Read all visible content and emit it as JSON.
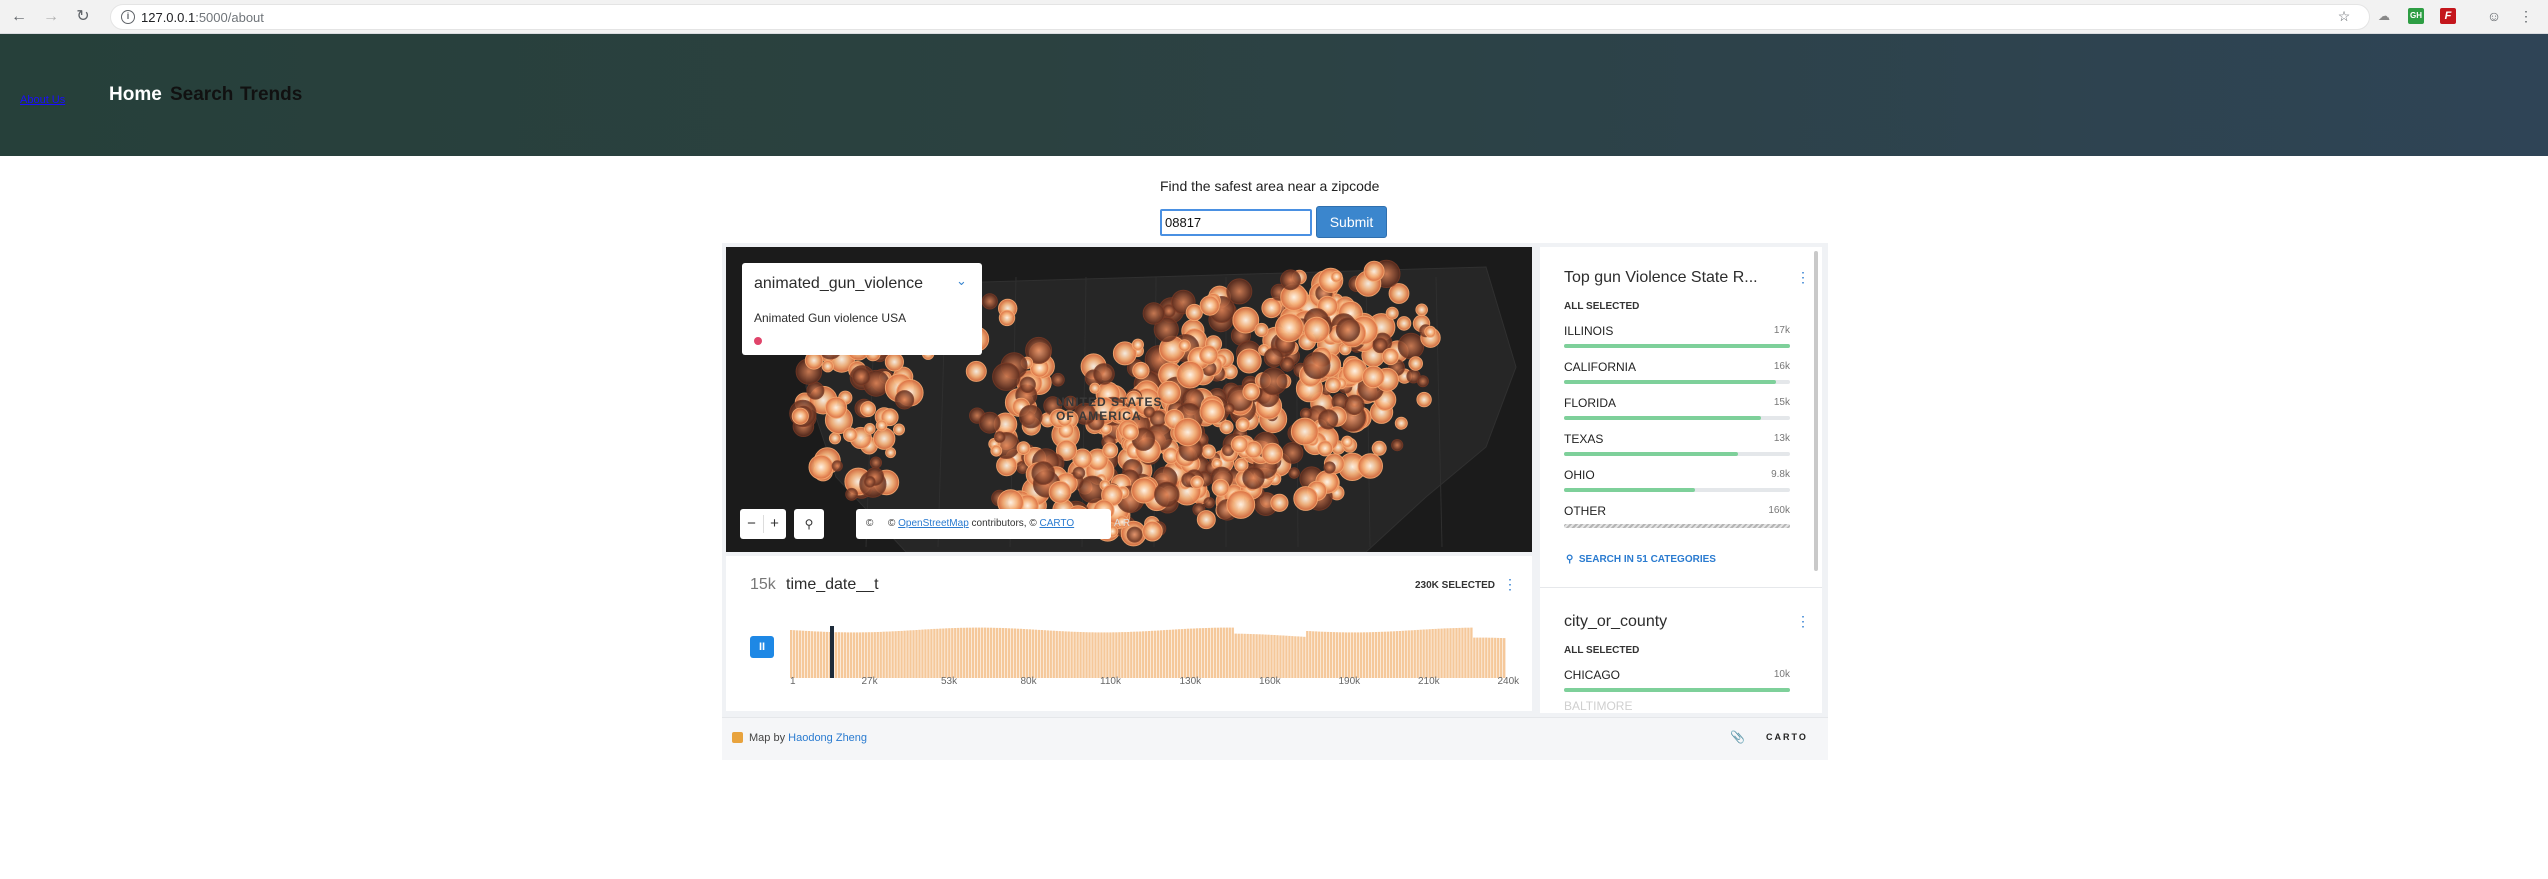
{
  "browser": {
    "url_host": "127.0.0.1",
    "url_path": ":5000/about",
    "ext_ghostery": "GH",
    "ext_flash": "F"
  },
  "header": {
    "logo_link": "About Us",
    "nav": [
      "Home",
      "Search",
      "Trends"
    ]
  },
  "zip_form": {
    "prompt": "Find the safest area near a zipcode",
    "value": "08817",
    "submit_label": "Submit"
  },
  "map": {
    "legend_title": "animated_gun_violence",
    "legend_subtitle": "Animated Gun violence USA",
    "legend_color": "#e0446a",
    "country_label_1": "UNITED STATES",
    "country_label_2": "OF AMERICA",
    "attribution_prefix": "© ",
    "attribution_osm": "OpenStreetMap",
    "attribution_mid": " contributors, © ",
    "attribution_carto": "CARTO",
    "overflow_text": "A R",
    "copyright_glyph": "©",
    "zoom_out": "−",
    "zoom_in": "+"
  },
  "time_series": {
    "count": "15k",
    "name": "time_date__t",
    "selected": "230K SELECTED",
    "play_label": "II",
    "ticks": [
      "1",
      "27k",
      "53k",
      "80k",
      "110k",
      "130k",
      "160k",
      "190k",
      "210k",
      "240k"
    ],
    "bar_color": "#f5c89a"
  },
  "state_widget": {
    "title": "Top gun Violence State R...",
    "all_selected": "ALL SELECTED",
    "categories": [
      {
        "name": "ILLINOIS",
        "value": "17k",
        "fraction": 1.0
      },
      {
        "name": "CALIFORNIA",
        "value": "16k",
        "fraction": 0.94
      },
      {
        "name": "FLORIDA",
        "value": "15k",
        "fraction": 0.87
      },
      {
        "name": "TEXAS",
        "value": "13k",
        "fraction": 0.77
      },
      {
        "name": "OHIO",
        "value": "9.8k",
        "fraction": 0.58
      },
      {
        "name": "OTHER",
        "value": "160k",
        "fraction": 1.0
      }
    ],
    "search_label": "SEARCH IN 51 CATEGORIES"
  },
  "city_widget": {
    "title": "city_or_county",
    "all_selected": "ALL SELECTED",
    "categories": [
      {
        "name": "CHICAGO",
        "value": "10k",
        "fraction": 1.0
      }
    ],
    "partial_item": "BALTIMORE"
  },
  "footer": {
    "map_by": "Map by ",
    "author": "Haodong Zheng",
    "brand": "CARTO"
  }
}
